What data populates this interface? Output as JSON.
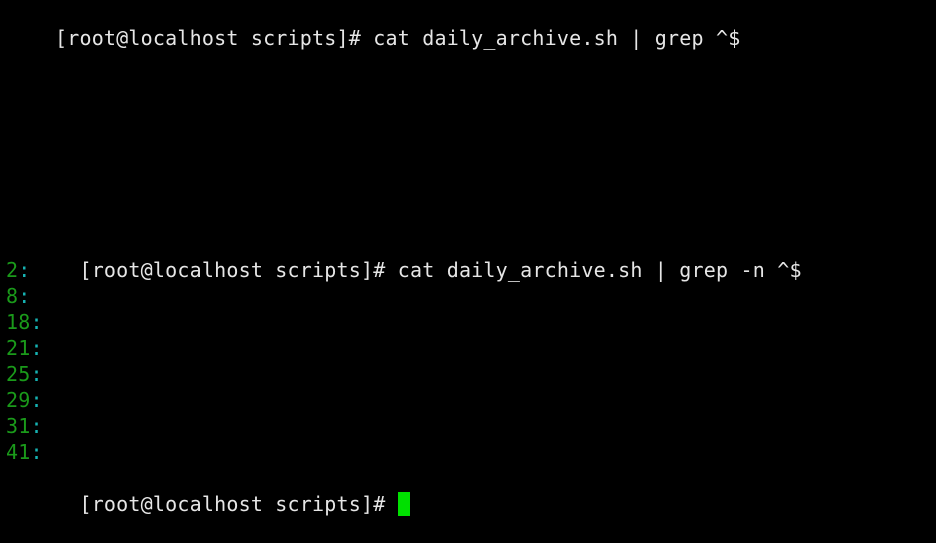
{
  "terminal": {
    "prompt": "[root@localhost scripts]# ",
    "command1": "cat daily_archive.sh | grep ^$",
    "command2": "cat daily_archive.sh | grep -n ^$",
    "results": [
      {
        "num": "2",
        "sep": ":"
      },
      {
        "num": "8",
        "sep": ":"
      },
      {
        "num": "18",
        "sep": ":"
      },
      {
        "num": "21",
        "sep": ":"
      },
      {
        "num": "25",
        "sep": ":"
      },
      {
        "num": "29",
        "sep": ":"
      },
      {
        "num": "31",
        "sep": ":"
      },
      {
        "num": "41",
        "sep": ":"
      }
    ],
    "colors": {
      "background": "#000000",
      "text": "#e6e6e6",
      "line_number": "#1a9a1a",
      "separator": "#16b3b3",
      "cursor": "#00e000"
    }
  }
}
